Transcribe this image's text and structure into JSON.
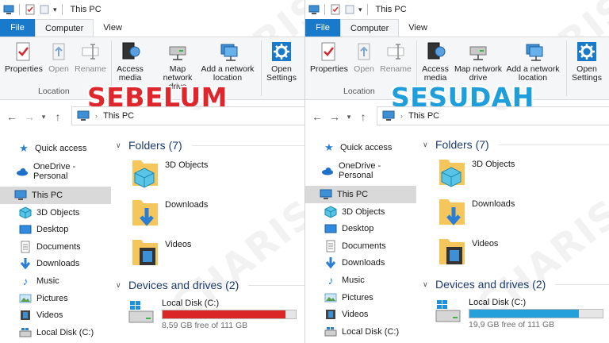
{
  "watermark": "CHARIS",
  "panes": [
    {
      "overlay": "SEBELUM",
      "overlay_color": "#e0262d",
      "window_title": "This PC",
      "tabs": [
        "File",
        "Computer",
        "View"
      ],
      "ribbon": {
        "properties": "Properties",
        "open": "Open",
        "rename": "Rename",
        "group_location": "Location",
        "access_media": "Access media",
        "map_network_drive": "Map network drive",
        "add_network_location": "Add a network location",
        "open_settings": "Open Settings"
      },
      "address": "This PC",
      "nav": {
        "quick_access": "Quick access",
        "onedrive": "OneDrive - Personal",
        "this_pc": "This PC",
        "objects3d": "3D Objects",
        "desktop": "Desktop",
        "documents": "Documents",
        "downloads": "Downloads",
        "music": "Music",
        "pictures": "Pictures",
        "videos": "Videos",
        "local_disk": "Local Disk (C:)"
      },
      "folders_header": "Folders (7)",
      "folders": [
        "3D Objects",
        "Downloads",
        "Videos"
      ],
      "devices_header": "Devices and drives (2)",
      "drive": {
        "name": "Local Disk (C:)",
        "free_text": "8,59 GB free of 111 GB",
        "used_fraction": 0.923,
        "bar_color": "#da2626"
      }
    },
    {
      "overlay": "SESUDAH",
      "overlay_color": "#1e9fdc",
      "window_title": "This PC",
      "tabs": [
        "File",
        "Computer",
        "View"
      ],
      "ribbon": {
        "properties": "Properties",
        "open": "Open",
        "rename": "Rename",
        "group_location": "Location",
        "access_media": "Access media",
        "map_network_drive": "Map network drive",
        "add_network_location": "Add a network location",
        "open_settings": "Open Settings"
      },
      "address": "This PC",
      "nav": {
        "quick_access": "Quick access",
        "onedrive": "OneDrive - Personal",
        "this_pc": "This PC",
        "objects3d": "3D Objects",
        "desktop": "Desktop",
        "documents": "Documents",
        "downloads": "Downloads",
        "music": "Music",
        "pictures": "Pictures",
        "videos": "Videos",
        "local_disk": "Local Disk (C:)"
      },
      "folders_header": "Folders (7)",
      "folders": [
        "3D Objects",
        "Downloads",
        "Videos"
      ],
      "devices_header": "Devices and drives (2)",
      "drive": {
        "name": "Local Disk (C:)",
        "free_text": "19,9 GB free of 111 GB",
        "used_fraction": 0.821,
        "bar_color": "#26a0da"
      }
    }
  ]
}
